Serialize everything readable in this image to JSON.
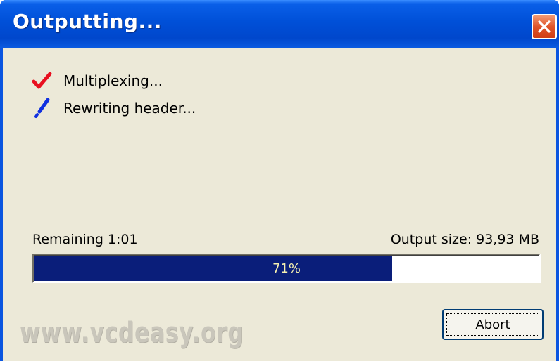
{
  "window": {
    "title": "Outputting..."
  },
  "tasks": [
    {
      "label": "Multiplexing...",
      "state": "done",
      "icon": "red-checkmark-icon"
    },
    {
      "label": "Rewriting header...",
      "state": "in-progress",
      "icon": "blue-pen-icon"
    }
  ],
  "progress": {
    "remaining_label": "Remaining 1:01",
    "output_size_label": "Output size: 93,93 MB",
    "percent": 71,
    "percent_text": "71%"
  },
  "buttons": {
    "abort_label": "Abort"
  },
  "watermark": "www.vcdeasy.org",
  "colors": {
    "titlebar": "#0050d8",
    "client_bg": "#ece9d8",
    "progress_fill": "#0a1e7a",
    "progress_text": "#f6f0b0",
    "check": "#e81020",
    "pen": "#1030e0"
  }
}
